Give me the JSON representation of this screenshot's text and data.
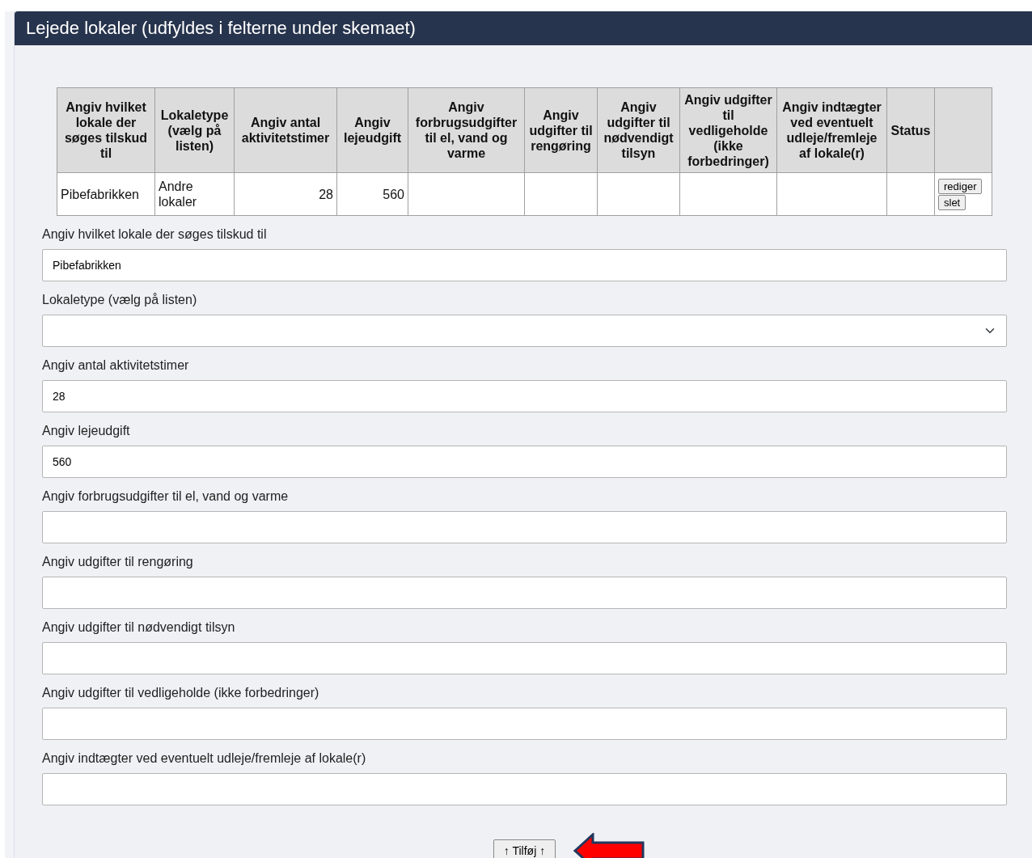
{
  "panel": {
    "title": "Lejede lokaler (udfyldes i felterne under skemaet)"
  },
  "table": {
    "columns": [
      {
        "label": "Angiv hvilket lokale der søges tilskud til",
        "numeric": false
      },
      {
        "label": "Lokaletype (vælg på listen)",
        "numeric": false
      },
      {
        "label": "Angiv antal aktivitetstimer",
        "numeric": true
      },
      {
        "label": "Angiv lejeudgift",
        "numeric": true
      },
      {
        "label": "Angiv forbrugsudgifter til el, vand og varme"
      },
      {
        "label": "Angiv udgifter til rengøring"
      },
      {
        "label": "Angiv udgifter til nødvendigt tilsyn"
      },
      {
        "label": "Angiv udgifter til vedligeholde (ikke forbedringer)"
      },
      {
        "label": "Angiv indtægter ved eventuelt udleje/fremleje af lokale(r)"
      },
      {
        "label": "Status"
      }
    ],
    "rows": [
      {
        "cells": [
          "Pibefabrikken",
          "Andre lokaler",
          "28",
          "560",
          null,
          null,
          null,
          null,
          null,
          null
        ],
        "actions": [
          "rediger",
          "slet"
        ]
      }
    ]
  },
  "form": {
    "fields": [
      {
        "kind": "text",
        "label": "Angiv hvilket lokale der søges tilskud til",
        "value": "Pibefabrikken"
      },
      {
        "kind": "select",
        "label": "Lokaletype (vælg på listen)"
      },
      {
        "kind": "text",
        "label": "Angiv antal aktivitetstimer",
        "value": "28"
      },
      {
        "kind": "text",
        "label": "Angiv lejeudgift",
        "value": "560"
      },
      {
        "kind": "text",
        "label": "Angiv forbrugsudgifter til el, vand og varme"
      },
      {
        "kind": "text",
        "label": "Angiv udgifter til rengøring"
      },
      {
        "kind": "text",
        "label": "Angiv udgifter til nødvendigt tilsyn"
      },
      {
        "kind": "text",
        "label": "Angiv udgifter til vedligeholde (ikke forbedringer)"
      },
      {
        "kind": "text",
        "label": "Angiv indtægter ved eventuelt udleje/fremleje af lokale(r)"
      }
    ],
    "submit": {
      "label": "↑ Tilføj ↑"
    }
  }
}
